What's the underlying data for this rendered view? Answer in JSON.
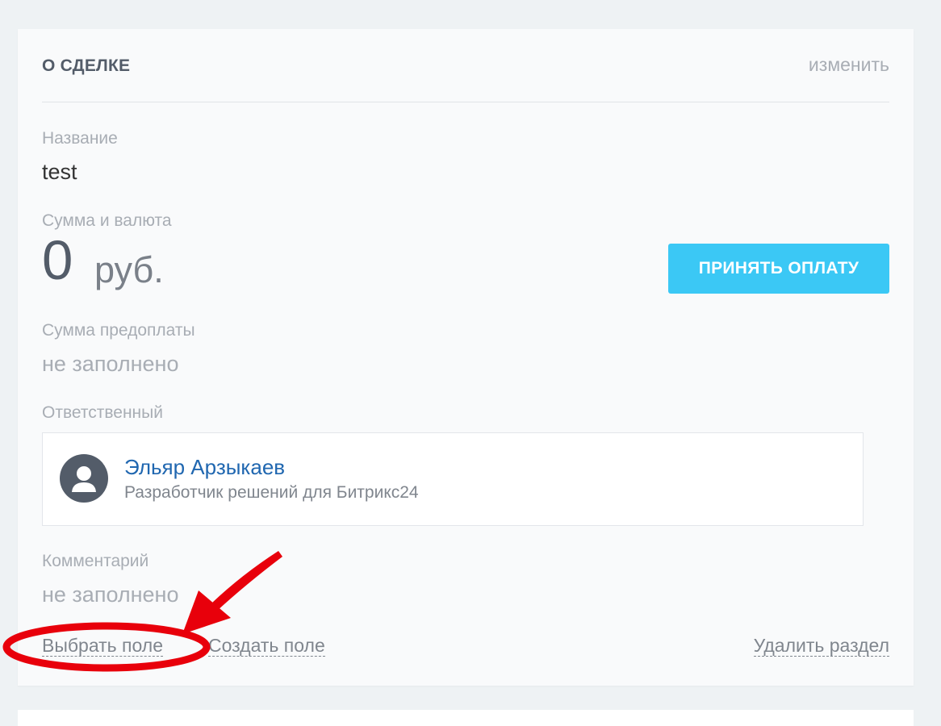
{
  "section": {
    "title": "О СДЕЛКЕ",
    "edit_label": "изменить"
  },
  "fields": {
    "name": {
      "label": "Название",
      "value": "test"
    },
    "amount": {
      "label": "Сумма и валюта",
      "value": "0",
      "currency": "руб."
    },
    "prepayment": {
      "label": "Сумма предоплаты",
      "value": "не заполнено"
    },
    "responsible": {
      "label": "Ответственный",
      "name": "Эльяр Арзыкаев",
      "role": "Разработчик решений для Битрикс24"
    },
    "comment": {
      "label": "Комментарий",
      "value": "не заполнено"
    }
  },
  "buttons": {
    "accept_payment": "ПРИНЯТЬ ОПЛАТУ"
  },
  "footer": {
    "select_field": "Выбрать поле",
    "create_field": "Создать поле",
    "delete_section": "Удалить раздел"
  },
  "icons": {
    "avatar": "user-silhouette-icon",
    "annotation_arrow": "red-arrow-icon",
    "annotation_ellipse": "red-highlight-ellipse"
  },
  "colors": {
    "accent": "#3bc8f5",
    "link": "#2067b0",
    "annotation": "#e8000b"
  }
}
